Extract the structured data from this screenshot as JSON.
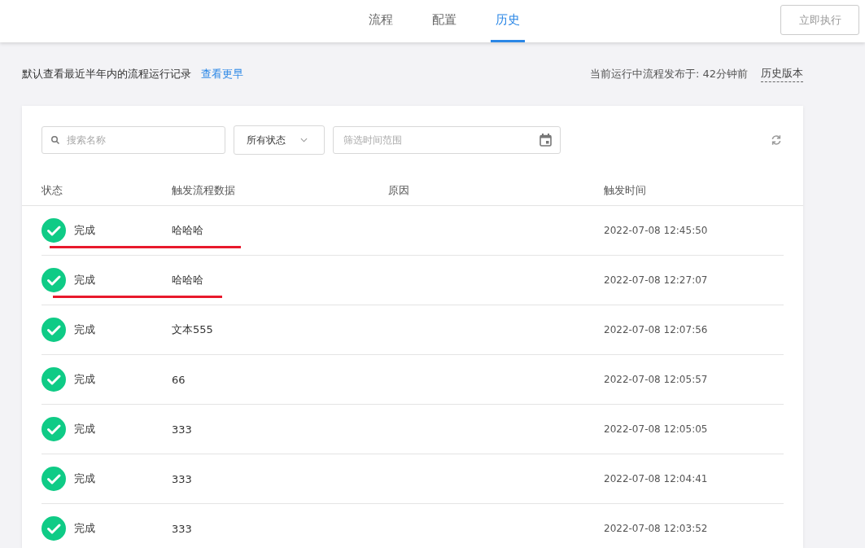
{
  "tabs": [
    {
      "label": "流程",
      "selected": false
    },
    {
      "label": "配置",
      "selected": false
    },
    {
      "label": "历史",
      "selected": true
    }
  ],
  "run_button": "立即执行",
  "info": {
    "text": "默认查看最近半年内的流程运行记录",
    "link": "查看更早",
    "published": "当前运行中流程发布于: 42分钟前",
    "versions": "历史版本"
  },
  "filters": {
    "search_placeholder": "搜索名称",
    "status": "所有状态",
    "date_placeholder": "筛选时间范围"
  },
  "table": {
    "columns": [
      "状态",
      "触发流程数据",
      "原因",
      "触发时间"
    ],
    "rows": [
      {
        "status": "完成",
        "data": "哈哈哈",
        "time": "2022-07-08 12:45:50",
        "marked": true
      },
      {
        "status": "完成",
        "data": "哈哈哈",
        "time": "2022-07-08 12:27:07",
        "marked": true
      },
      {
        "status": "完成",
        "data": "文本555",
        "time": "2022-07-08 12:07:56",
        "marked": false
      },
      {
        "status": "完成",
        "data": "66",
        "time": "2022-07-08 12:05:57",
        "marked": false
      },
      {
        "status": "完成",
        "data": "333",
        "time": "2022-07-08 12:05:05",
        "marked": false
      },
      {
        "status": "完成",
        "data": "333",
        "time": "2022-07-08 12:04:41",
        "marked": false
      },
      {
        "status": "完成",
        "data": "333",
        "time": "2022-07-08 12:03:52",
        "marked": false
      }
    ]
  }
}
